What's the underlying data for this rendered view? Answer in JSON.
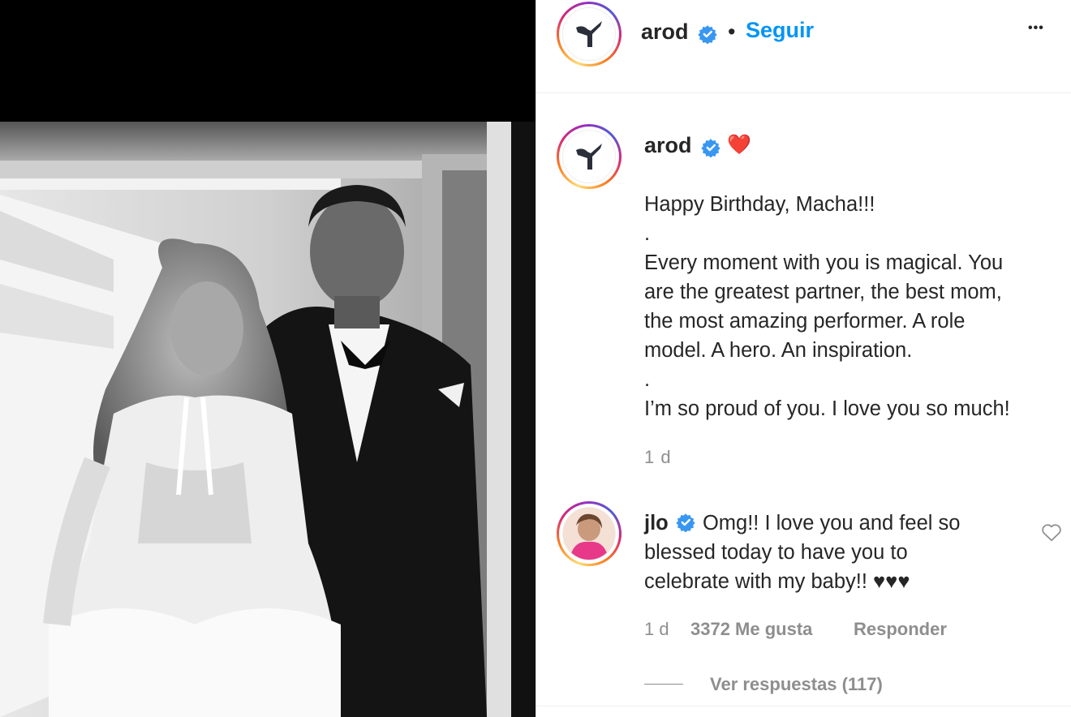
{
  "post": {
    "username": "arod",
    "dot": "•",
    "follow_label": "Seguir",
    "more_label": "•••",
    "heart_emoji": "❤️",
    "caption": {
      "line1": "Happy Birthday, Macha!!!",
      "line2": ".",
      "line3": "Every moment with you is magical. You",
      "line4": "are the greatest partner, the best mom,",
      "line5": "the most amazing performer. A role",
      "line6": "model. A hero. An inspiration.",
      "line7": ".",
      "line8": "I’m so proud of you. I love you so much!"
    },
    "time": "1 d"
  },
  "comment": {
    "username": "jlo",
    "line1": "Omg!! I love you and feel so",
    "line2": "blessed today to have you to",
    "line3": "celebrate with my baby!! ♥♥♥",
    "time": "1 d",
    "likes": "3372 Me gusta",
    "reply_label": "Responder",
    "view_replies": "Ver respuestas (117)"
  },
  "colors": {
    "link": "#0095f6",
    "verified": "#3897f0",
    "muted": "#8e8e8e",
    "text": "#262626"
  },
  "icons": [
    "verified-badge-icon",
    "more-options-icon",
    "like-heart-icon",
    "avatar-logo-icon"
  ]
}
